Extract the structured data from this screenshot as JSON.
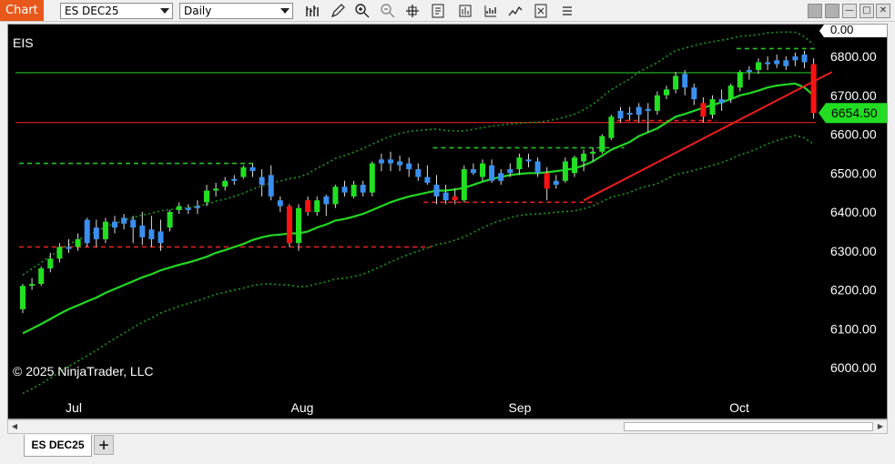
{
  "toolbar": {
    "chart_tab": "Chart",
    "instrument": "ES DEC25",
    "period": "Daily",
    "icons": [
      "bar-type-icon",
      "draw-pencil-icon",
      "zoom-in-icon",
      "zoom-out-icon",
      "crosshair-icon",
      "properties-icon",
      "data-box-icon",
      "indicators-icon",
      "strategies-icon",
      "attach-icon",
      "more-icon"
    ],
    "window_buttons": [
      "minimize-icon",
      "maximize-icon",
      "close-icon"
    ]
  },
  "chart": {
    "instrument_label": "EIS",
    "copyright": "© 2025 NinjaTrader, LLC",
    "price_marker": "6654.50",
    "top_marker": "0.00",
    "colors": {
      "up": "#21e021",
      "down": "#ff1111",
      "neutral_up": "#3a8ff0",
      "sma": "#22d822",
      "bands": "#1a9a1a",
      "hline_green": "#27c027",
      "hline_red": "#e02020",
      "marker_bg": "#22dd22"
    }
  },
  "chart_data": {
    "type": "candlestick",
    "ylim": [
      5990,
      6830
    ],
    "y_ticks": [
      "6800.00",
      "6700.00",
      "6600.00",
      "6500.00",
      "6400.00",
      "6300.00",
      "6200.00",
      "6100.00",
      "6000.00"
    ],
    "x_labels": [
      "Jul",
      "Aug",
      "Sep",
      "Oct"
    ],
    "candles": [
      {
        "o": 6150,
        "h": 6215,
        "l": 6140,
        "c": 6210,
        "t": "up"
      },
      {
        "o": 6210,
        "h": 6230,
        "l": 6200,
        "c": 6215,
        "t": "up"
      },
      {
        "o": 6215,
        "h": 6260,
        "l": 6210,
        "c": 6255,
        "t": "up"
      },
      {
        "o": 6255,
        "h": 6295,
        "l": 6245,
        "c": 6280,
        "t": "up"
      },
      {
        "o": 6280,
        "h": 6320,
        "l": 6270,
        "c": 6310,
        "t": "up"
      },
      {
        "o": 6305,
        "h": 6330,
        "l": 6295,
        "c": 6310,
        "t": "blue"
      },
      {
        "o": 6310,
        "h": 6345,
        "l": 6300,
        "c": 6330,
        "t": "up"
      },
      {
        "o": 6380,
        "h": 6385,
        "l": 6310,
        "c": 6320,
        "t": "blue"
      },
      {
        "o": 6360,
        "h": 6380,
        "l": 6310,
        "c": 6330,
        "t": "blue"
      },
      {
        "o": 6330,
        "h": 6385,
        "l": 6320,
        "c": 6375,
        "t": "up"
      },
      {
        "o": 6375,
        "h": 6390,
        "l": 6345,
        "c": 6360,
        "t": "blue"
      },
      {
        "o": 6385,
        "h": 6395,
        "l": 6355,
        "c": 6370,
        "t": "blue"
      },
      {
        "o": 6380,
        "h": 6390,
        "l": 6320,
        "c": 6360,
        "t": "blue"
      },
      {
        "o": 6365,
        "h": 6400,
        "l": 6315,
        "c": 6335,
        "t": "blue"
      },
      {
        "o": 6355,
        "h": 6390,
        "l": 6310,
        "c": 6330,
        "t": "blue"
      },
      {
        "o": 6350,
        "h": 6380,
        "l": 6300,
        "c": 6320,
        "t": "blue"
      },
      {
        "o": 6360,
        "h": 6405,
        "l": 6350,
        "c": 6400,
        "t": "up"
      },
      {
        "o": 6405,
        "h": 6425,
        "l": 6395,
        "c": 6415,
        "t": "up"
      },
      {
        "o": 6410,
        "h": 6420,
        "l": 6395,
        "c": 6405,
        "t": "blue"
      },
      {
        "o": 6415,
        "h": 6430,
        "l": 6395,
        "c": 6410,
        "t": "blue"
      },
      {
        "o": 6425,
        "h": 6470,
        "l": 6415,
        "c": 6455,
        "t": "up"
      },
      {
        "o": 6455,
        "h": 6475,
        "l": 6440,
        "c": 6460,
        "t": "up"
      },
      {
        "o": 6465,
        "h": 6490,
        "l": 6455,
        "c": 6480,
        "t": "up"
      },
      {
        "o": 6480,
        "h": 6495,
        "l": 6470,
        "c": 6485,
        "t": "blue"
      },
      {
        "o": 6490,
        "h": 6520,
        "l": 6485,
        "c": 6515,
        "t": "up"
      },
      {
        "o": 6515,
        "h": 6525,
        "l": 6490,
        "c": 6505,
        "t": "blue"
      },
      {
        "o": 6490,
        "h": 6510,
        "l": 6440,
        "c": 6470,
        "t": "blue"
      },
      {
        "o": 6495,
        "h": 6520,
        "l": 6430,
        "c": 6440,
        "t": "blue"
      },
      {
        "o": 6430,
        "h": 6440,
        "l": 6400,
        "c": 6415,
        "t": "blue"
      },
      {
        "o": 6415,
        "h": 6420,
        "l": 6310,
        "c": 6320,
        "t": "down"
      },
      {
        "o": 6320,
        "h": 6420,
        "l": 6300,
        "c": 6410,
        "t": "up"
      },
      {
        "o": 6430,
        "h": 6440,
        "l": 6390,
        "c": 6400,
        "t": "down"
      },
      {
        "o": 6400,
        "h": 6440,
        "l": 6390,
        "c": 6430,
        "t": "up"
      },
      {
        "o": 6440,
        "h": 6445,
        "l": 6390,
        "c": 6420,
        "t": "blue"
      },
      {
        "o": 6420,
        "h": 6470,
        "l": 6410,
        "c": 6465,
        "t": "up"
      },
      {
        "o": 6465,
        "h": 6480,
        "l": 6440,
        "c": 6450,
        "t": "blue"
      },
      {
        "o": 6440,
        "h": 6480,
        "l": 6435,
        "c": 6470,
        "t": "up"
      },
      {
        "o": 6470,
        "h": 6480,
        "l": 6440,
        "c": 6450,
        "t": "blue"
      },
      {
        "o": 6450,
        "h": 6530,
        "l": 6440,
        "c": 6525,
        "t": "up"
      },
      {
        "o": 6525,
        "h": 6550,
        "l": 6505,
        "c": 6535,
        "t": "blue"
      },
      {
        "o": 6535,
        "h": 6555,
        "l": 6505,
        "c": 6525,
        "t": "blue"
      },
      {
        "o": 6530,
        "h": 6545,
        "l": 6505,
        "c": 6520,
        "t": "blue"
      },
      {
        "o": 6525,
        "h": 6540,
        "l": 6490,
        "c": 6510,
        "t": "blue"
      },
      {
        "o": 6510,
        "h": 6525,
        "l": 6480,
        "c": 6490,
        "t": "blue"
      },
      {
        "o": 6490,
        "h": 6520,
        "l": 6470,
        "c": 6475,
        "t": "blue"
      },
      {
        "o": 6470,
        "h": 6495,
        "l": 6420,
        "c": 6440,
        "t": "blue"
      },
      {
        "o": 6450,
        "h": 6470,
        "l": 6420,
        "c": 6430,
        "t": "blue"
      },
      {
        "o": 6440,
        "h": 6460,
        "l": 6420,
        "c": 6430,
        "t": "down"
      },
      {
        "o": 6430,
        "h": 6520,
        "l": 6425,
        "c": 6510,
        "t": "up"
      },
      {
        "o": 6510,
        "h": 6525,
        "l": 6495,
        "c": 6500,
        "t": "blue"
      },
      {
        "o": 6490,
        "h": 6535,
        "l": 6480,
        "c": 6525,
        "t": "up"
      },
      {
        "o": 6520,
        "h": 6535,
        "l": 6475,
        "c": 6480,
        "t": "blue"
      },
      {
        "o": 6480,
        "h": 6510,
        "l": 6470,
        "c": 6500,
        "t": "blue"
      },
      {
        "o": 6500,
        "h": 6525,
        "l": 6490,
        "c": 6510,
        "t": "blue"
      },
      {
        "o": 6510,
        "h": 6550,
        "l": 6495,
        "c": 6540,
        "t": "up"
      },
      {
        "o": 6535,
        "h": 6550,
        "l": 6515,
        "c": 6530,
        "t": "blue"
      },
      {
        "o": 6530,
        "h": 6540,
        "l": 6490,
        "c": 6500,
        "t": "blue"
      },
      {
        "o": 6500,
        "h": 6515,
        "l": 6430,
        "c": 6460,
        "t": "down"
      },
      {
        "o": 6470,
        "h": 6495,
        "l": 6460,
        "c": 6480,
        "t": "blue"
      },
      {
        "o": 6480,
        "h": 6540,
        "l": 6475,
        "c": 6530,
        "t": "up"
      },
      {
        "o": 6500,
        "h": 6545,
        "l": 6490,
        "c": 6540,
        "t": "up"
      },
      {
        "o": 6530,
        "h": 6560,
        "l": 6505,
        "c": 6550,
        "t": "up"
      },
      {
        "o": 6550,
        "h": 6565,
        "l": 6530,
        "c": 6555,
        "t": "up"
      },
      {
        "o": 6555,
        "h": 6600,
        "l": 6550,
        "c": 6595,
        "t": "up"
      },
      {
        "o": 6590,
        "h": 6650,
        "l": 6585,
        "c": 6645,
        "t": "up"
      },
      {
        "o": 6640,
        "h": 6670,
        "l": 6630,
        "c": 6660,
        "t": "blue"
      },
      {
        "o": 6655,
        "h": 6670,
        "l": 6635,
        "c": 6650,
        "t": "blue"
      },
      {
        "o": 6650,
        "h": 6680,
        "l": 6630,
        "c": 6670,
        "t": "blue"
      },
      {
        "o": 6665,
        "h": 6680,
        "l": 6605,
        "c": 6660,
        "t": "blue"
      },
      {
        "o": 6660,
        "h": 6710,
        "l": 6650,
        "c": 6700,
        "t": "up"
      },
      {
        "o": 6700,
        "h": 6725,
        "l": 6690,
        "c": 6715,
        "t": "up"
      },
      {
        "o": 6715,
        "h": 6760,
        "l": 6705,
        "c": 6750,
        "t": "up"
      },
      {
        "o": 6755,
        "h": 6765,
        "l": 6700,
        "c": 6720,
        "t": "blue"
      },
      {
        "o": 6720,
        "h": 6730,
        "l": 6675,
        "c": 6690,
        "t": "blue"
      },
      {
        "o": 6680,
        "h": 6695,
        "l": 6630,
        "c": 6645,
        "t": "down"
      },
      {
        "o": 6650,
        "h": 6700,
        "l": 6640,
        "c": 6690,
        "t": "up"
      },
      {
        "o": 6690,
        "h": 6715,
        "l": 6660,
        "c": 6680,
        "t": "blue"
      },
      {
        "o": 6690,
        "h": 6730,
        "l": 6680,
        "c": 6725,
        "t": "up"
      },
      {
        "o": 6720,
        "h": 6765,
        "l": 6710,
        "c": 6760,
        "t": "up"
      },
      {
        "o": 6760,
        "h": 6775,
        "l": 6740,
        "c": 6765,
        "t": "blue"
      },
      {
        "o": 6765,
        "h": 6795,
        "l": 6755,
        "c": 6785,
        "t": "up"
      },
      {
        "o": 6785,
        "h": 6800,
        "l": 6765,
        "c": 6780,
        "t": "blue"
      },
      {
        "o": 6790,
        "h": 6805,
        "l": 6770,
        "c": 6780,
        "t": "blue"
      },
      {
        "o": 6775,
        "h": 6800,
        "l": 6765,
        "c": 6790,
        "t": "blue"
      },
      {
        "o": 6790,
        "h": 6810,
        "l": 6775,
        "c": 6800,
        "t": "blue"
      },
      {
        "o": 6805,
        "h": 6815,
        "l": 6770,
        "c": 6785,
        "t": "blue"
      },
      {
        "o": 6780,
        "h": 6795,
        "l": 6640,
        "c": 6654.5,
        "t": "down"
      }
    ],
    "horizontal_lines": [
      {
        "y": 6758,
        "style": "solid",
        "color": "green"
      },
      {
        "y": 6630,
        "style": "solid",
        "color": "red"
      },
      {
        "y": 6525,
        "style": "dashed",
        "color": "green",
        "x0": 0,
        "x1": 25
      },
      {
        "y": 6310,
        "style": "dashed",
        "color": "red",
        "x0": 0,
        "x1": 44
      },
      {
        "y": 6565,
        "style": "dashed",
        "color": "green",
        "x0": 45,
        "x1": 65
      },
      {
        "y": 6425,
        "style": "dashed",
        "color": "red",
        "x0": 44,
        "x1": 62
      },
      {
        "y": 6635,
        "style": "dashed",
        "color": "red",
        "x0": 65,
        "x1": 75
      },
      {
        "y": 6820,
        "style": "dashed",
        "color": "green",
        "x0": 78,
        "x1": 86
      }
    ],
    "trendline": {
      "x0": 61,
      "y0": 6430,
      "x1": 88,
      "y1": 6760
    },
    "sma": [
      6088,
      6100,
      6112,
      6125,
      6138,
      6150,
      6160,
      6170,
      6180,
      6192,
      6202,
      6212,
      6222,
      6232,
      6240,
      6250,
      6257,
      6264,
      6270,
      6277,
      6285,
      6295,
      6302,
      6310,
      6318,
      6328,
      6335,
      6340,
      6342,
      6345,
      6345,
      6350,
      6360,
      6368,
      6378,
      6382,
      6388,
      6395,
      6405,
      6415,
      6425,
      6433,
      6440,
      6445,
      6450,
      6455,
      6455,
      6458,
      6462,
      6470,
      6478,
      6485,
      6490,
      6495,
      6498,
      6500,
      6500,
      6502,
      6505,
      6508,
      6512,
      6520,
      6530,
      6545,
      6560,
      6570,
      6580,
      6595,
      6605,
      6615,
      6630,
      6645,
      6652,
      6660,
      6668,
      6675,
      6682,
      6690,
      6700,
      6705,
      6712,
      6720,
      6725,
      6728,
      6730,
      6720,
      6700
    ]
  }
}
